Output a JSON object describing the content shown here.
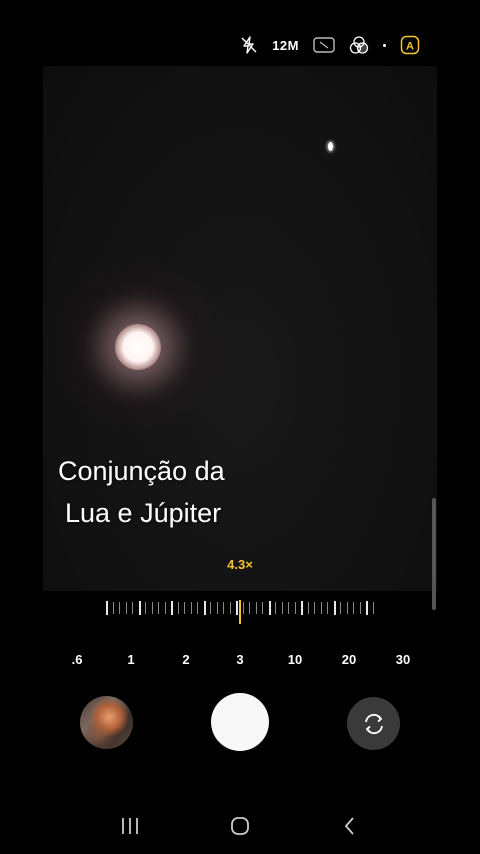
{
  "top_bar": {
    "flash_icon": "flash-off-icon",
    "megapixels": "12M",
    "aspect_icon": "aspect-ratio-icon",
    "filter_icon": "filter-icon",
    "auto_label": "A"
  },
  "viewfinder": {
    "overlay_line1": "Conjunção da",
    "overlay_line2": "Lua e Júpiter",
    "zoom_value": "4.3×"
  },
  "zoom_scale": {
    "labels": [
      ".6",
      "1",
      "2",
      "3",
      "10",
      "20",
      "30"
    ],
    "current_zoom": 4.3
  },
  "controls": {
    "gallery_icon": "gallery-thumbnail",
    "shutter_icon": "shutter-button",
    "flip_icon": "switch-camera-icon"
  },
  "nav": {
    "recents_icon": "recents-icon",
    "home_icon": "home-icon",
    "back_icon": "back-icon"
  },
  "colors": {
    "accent": "#f4c430",
    "background": "#000000"
  }
}
